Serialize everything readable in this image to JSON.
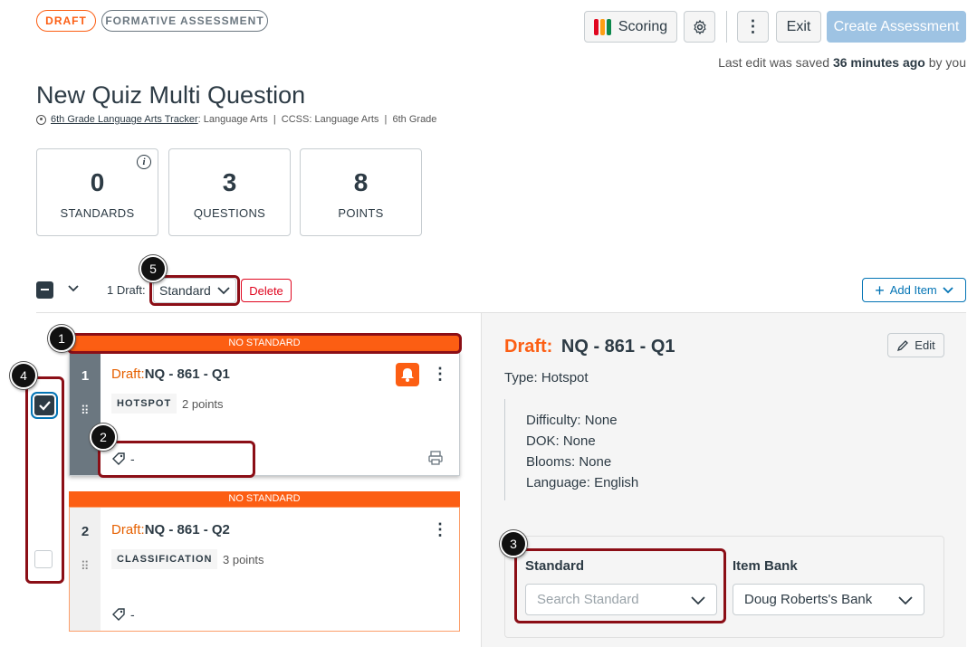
{
  "header": {
    "status_pill": "DRAFT",
    "type_pill": "FORMATIVE ASSESSMENT",
    "scoring_label": "Scoring",
    "exit_label": "Exit",
    "create_label": "Create Assessment",
    "save_prefix": "Last edit was saved ",
    "save_time": "36 minutes ago",
    "save_suffix": " by you"
  },
  "assessment": {
    "title": "New Quiz Multi Question",
    "tracker_link": "6th Grade Language Arts Tracker",
    "meta": ": Language Arts  |  CCSS: Language Arts  |  6th Grade"
  },
  "stats": [
    {
      "value": "0",
      "label": "STANDARDS"
    },
    {
      "value": "3",
      "label": "QUESTIONS"
    },
    {
      "value": "8",
      "label": "POINTS"
    }
  ],
  "toolbar": {
    "draft_count": "1 Draft:",
    "standard_select": "Standard",
    "delete_label": "Delete",
    "add_item_label": "Add Item"
  },
  "questions": [
    {
      "banner": "NO STANDARD",
      "number": "1",
      "draft": "Draft:",
      "name": "NQ - 861 - Q1",
      "type": "HOTSPOT",
      "points": "2 points",
      "tags": "-"
    },
    {
      "banner": "NO STANDARD",
      "number": "2",
      "draft": "Draft:",
      "name": "NQ - 861 - Q2",
      "type": "CLASSIFICATION",
      "points": "3 points",
      "tags": "-"
    }
  ],
  "detail": {
    "draft": "Draft:",
    "name": "NQ - 861 - Q1",
    "edit_label": "Edit",
    "type_line": "Type: Hotspot",
    "difficulty": "Difficulty: None",
    "dok": "DOK: None",
    "blooms": "Blooms: None",
    "language": "Language: English",
    "standard_label": "Standard",
    "standard_placeholder": "Search Standard",
    "item_bank_label": "Item Bank",
    "item_bank_value": "Doug Roberts's Bank"
  },
  "callouts": [
    "1",
    "2",
    "3",
    "4",
    "5"
  ],
  "colors": {
    "accent_orange": "#fc5e13",
    "callout_red": "#8b0e16",
    "primary_blue": "#0374b5",
    "disabled_blue": "#9ec3e3"
  }
}
